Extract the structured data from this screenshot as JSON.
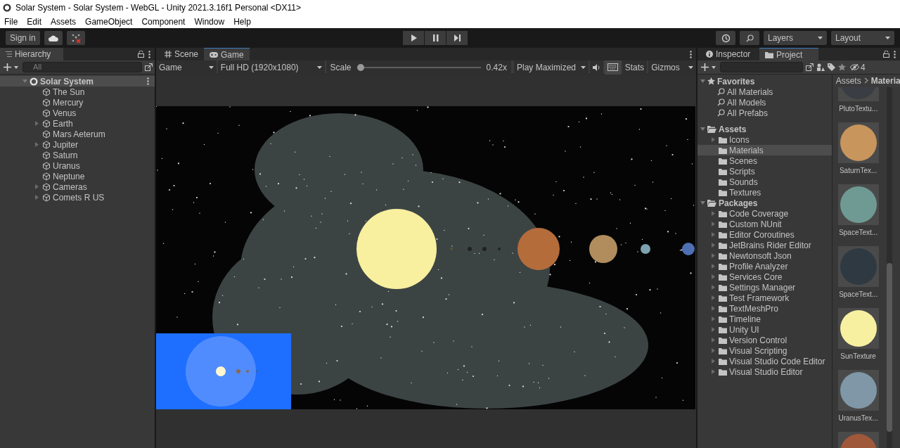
{
  "window": {
    "title": "Solar System - Solar System - WebGL - Unity 2021.3.16f1 Personal <DX11>"
  },
  "menu": [
    "File",
    "Edit",
    "Assets",
    "GameObject",
    "Component",
    "Window",
    "Help"
  ],
  "toolbar": {
    "sign_in": "Sign in",
    "layers": "Layers",
    "layout": "Layout"
  },
  "hierarchy": {
    "title": "Hierarchy",
    "search_placeholder": "All",
    "root": {
      "label": "Solar System",
      "expanded": true,
      "children": [
        {
          "label": "The Sun",
          "expandable": false
        },
        {
          "label": "Mercury",
          "expandable": false
        },
        {
          "label": "Venus",
          "expandable": false
        },
        {
          "label": "Earth",
          "expandable": true
        },
        {
          "label": "Mars Aeterum",
          "expandable": false
        },
        {
          "label": "Jupiter",
          "expandable": true
        },
        {
          "label": "Saturn",
          "expandable": false
        },
        {
          "label": "Uranus",
          "expandable": false
        },
        {
          "label": "Neptune",
          "expandable": false
        },
        {
          "label": "Cameras",
          "expandable": true
        },
        {
          "label": "Comets R US",
          "expandable": true
        }
      ]
    }
  },
  "game_view": {
    "tabs": [
      {
        "label": "Scene",
        "kind": "scene",
        "selected": false
      },
      {
        "label": "Game",
        "kind": "game",
        "selected": true
      }
    ],
    "display": "Game",
    "resolution": "Full HD (1920x1080)",
    "scale_label": "Scale",
    "scale": {
      "level": 0.0
    },
    "scale_value": "0.42x",
    "play_mode": "Play Maximized",
    "stats": "Stats",
    "gizmos": "Gizmos"
  },
  "project": {
    "tabs": [
      {
        "label": "Inspector",
        "kind": "info",
        "selected": false
      },
      {
        "label": "Project",
        "kind": "folder",
        "selected": true
      }
    ],
    "hidden_count": "4",
    "favorites": {
      "label": "Favorites",
      "items": [
        "All Materials",
        "All Models",
        "All Prefabs"
      ]
    },
    "tree": [
      {
        "label": "Assets",
        "expanded": true,
        "children": [
          {
            "label": "Icons",
            "expandable": true,
            "selected": false
          },
          {
            "label": "Materials",
            "expandable": false,
            "selected": true
          },
          {
            "label": "Scenes",
            "expandable": false,
            "selected": false
          },
          {
            "label": "Scripts",
            "expandable": false,
            "selected": false
          },
          {
            "label": "Sounds",
            "expandable": false,
            "selected": false
          },
          {
            "label": "Textures",
            "expandable": false,
            "selected": false
          }
        ]
      },
      {
        "label": "Packages",
        "expanded": true,
        "children": [
          {
            "label": "Code Coverage",
            "expandable": true,
            "selected": false
          },
          {
            "label": "Custom NUnit",
            "expandable": true,
            "selected": false
          },
          {
            "label": "Editor Coroutines",
            "expandable": true,
            "selected": false
          },
          {
            "label": "JetBrains Rider Editor",
            "expandable": true,
            "selected": false
          },
          {
            "label": "Newtonsoft Json",
            "expandable": true,
            "selected": false
          },
          {
            "label": "Profile Analyzer",
            "expandable": true,
            "selected": false
          },
          {
            "label": "Services Core",
            "expandable": true,
            "selected": false
          },
          {
            "label": "Settings Manager",
            "expandable": true,
            "selected": false
          },
          {
            "label": "Test Framework",
            "expandable": true,
            "selected": false
          },
          {
            "label": "TextMeshPro",
            "expandable": true,
            "selected": false
          },
          {
            "label": "Timeline",
            "expandable": true,
            "selected": false
          },
          {
            "label": "Unity UI",
            "expandable": true,
            "selected": false
          },
          {
            "label": "Version Control",
            "expandable": true,
            "selected": false
          },
          {
            "label": "Visual Scripting",
            "expandable": true,
            "selected": false
          },
          {
            "label": "Visual Studio Code Editor",
            "expandable": true,
            "selected": false
          },
          {
            "label": "Visual Studio Editor",
            "expandable": true,
            "selected": false
          }
        ]
      }
    ],
    "breadcrumb": [
      "Assets",
      "Materia"
    ],
    "thumbnails": [
      {
        "label": "PlutoTextu...",
        "color": "#3a3e44"
      },
      {
        "label": "SaturnTex...",
        "color": "#c8955c"
      },
      {
        "label": "SpaceText...",
        "color": "#6f9a94"
      },
      {
        "label": "SpaceText...",
        "color": "#2f3942"
      },
      {
        "label": "SunTexture",
        "color": "#f7f0a0"
      },
      {
        "label": "UranusTex...",
        "color": "#7f97a6"
      },
      {
        "color": "#a0583a"
      }
    ]
  }
}
